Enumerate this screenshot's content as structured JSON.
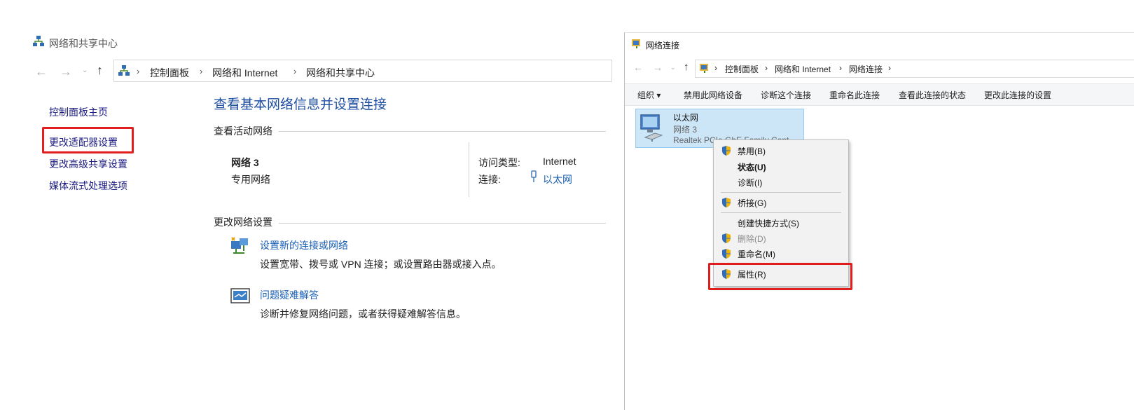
{
  "left_window": {
    "title": "网络和共享中心",
    "breadcrumbs": [
      "控制面板",
      "网络和 Internet",
      "网络和共享中心"
    ],
    "sidebar": [
      {
        "label": "控制面板主页"
      },
      {
        "label": "更改适配器设置"
      },
      {
        "label": "更改高级共享设置"
      },
      {
        "label": "媒体流式处理选项"
      }
    ],
    "heading": "查看基本网络信息并设置连接",
    "active_networks_label": "查看活动网络",
    "network_name": "网络 3",
    "network_type": "专用网络",
    "access_type_label": "访问类型:",
    "access_type_value": "Internet",
    "connection_label": "连接:",
    "connection_value": "以太网",
    "change_settings_label": "更改网络设置",
    "tasks": [
      {
        "link": "设置新的连接或网络",
        "desc": "设置宽带、拨号或 VPN 连接；或设置路由器或接入点。"
      },
      {
        "link": "问题疑难解答",
        "desc": "诊断并修复网络问题，或者获得疑难解答信息。"
      }
    ]
  },
  "right_window": {
    "title": "网络连接",
    "breadcrumbs": [
      "控制面板",
      "网络和 Internet",
      "网络连接"
    ],
    "toolbar": {
      "organize": "组织 ▾",
      "items": [
        "禁用此网络设备",
        "诊断这个连接",
        "重命名此连接",
        "查看此连接的状态",
        "更改此连接的设置"
      ]
    },
    "adapter": {
      "name": "以太网",
      "network": "网络 3",
      "device": "Realtek PCIe GbE Family Cont..."
    },
    "context_menu": [
      {
        "label": "禁用(B)",
        "shield": true
      },
      {
        "label": "状态(U)",
        "bold": true
      },
      {
        "label": "诊断(I)"
      },
      {
        "label": "桥接(G)",
        "shield": true
      },
      {
        "label": "创建快捷方式(S)"
      },
      {
        "label": "删除(D)",
        "shield": true,
        "disabled": true
      },
      {
        "label": "重命名(M)",
        "shield": true
      },
      {
        "label": "属性(R)",
        "shield": true
      }
    ]
  },
  "colors": {
    "highlight_box": "#e01e1e",
    "link": "#1a5fb4",
    "selection": "#cce6f8"
  }
}
